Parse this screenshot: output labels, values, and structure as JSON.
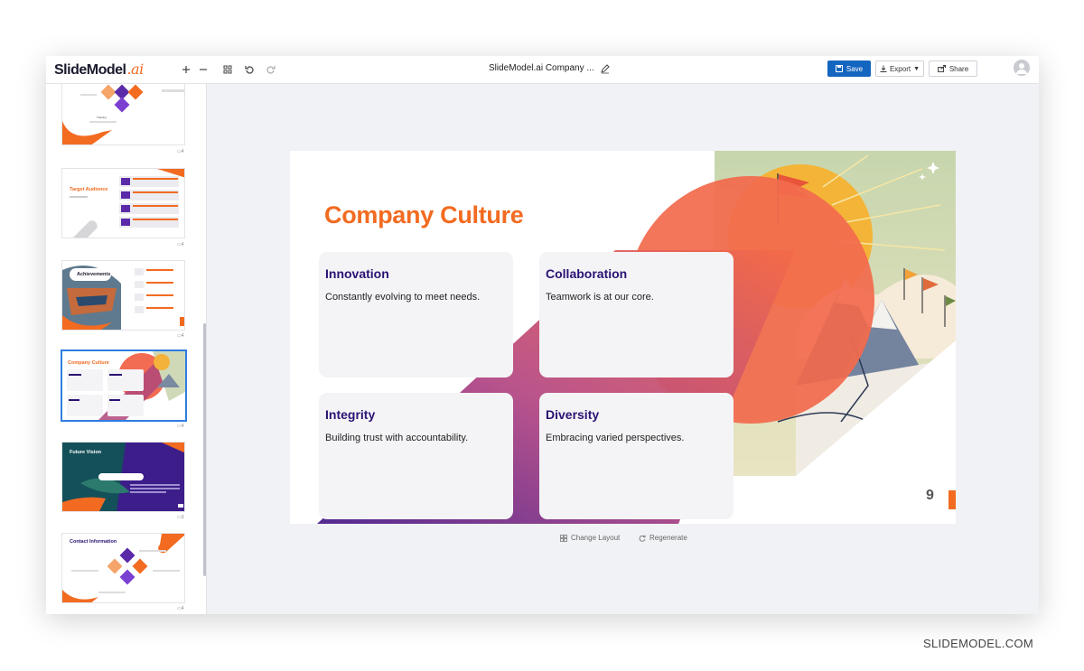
{
  "app": {
    "logo_text": "SlideModel",
    "logo_suffix": ".ai",
    "document_title": "SlideModel.ai Company ...",
    "save_label": "Save",
    "export_label": "Export",
    "share_label": "Share"
  },
  "sidebar": {
    "thumbnails": [
      {
        "title": "",
        "small": "Training"
      },
      {
        "title": "Target Audience",
        "small": ""
      },
      {
        "title": "Achievements",
        "small": ""
      },
      {
        "title": "Company Culture",
        "small": ""
      },
      {
        "title": "Future Vision",
        "small": ""
      },
      {
        "title": "Contact Information",
        "small": ""
      }
    ]
  },
  "slide": {
    "title": "Company Culture",
    "cards": [
      {
        "heading": "Innovation",
        "text": "Constantly evolving to meet needs."
      },
      {
        "heading": "Collaboration",
        "text": "Teamwork is at our core."
      },
      {
        "heading": "Integrity",
        "text": "Building trust with accountability."
      },
      {
        "heading": "Diversity",
        "text": "Embracing varied perspectives."
      }
    ],
    "page_number": "9"
  },
  "actions": {
    "change_layout": "Change Layout",
    "regenerate": "Regenerate"
  },
  "watermark": "SLIDEMODEL.COM",
  "colors": {
    "accent_orange": "#f26b21",
    "heading_purple": "#2a1272",
    "save_blue": "#1465c0"
  }
}
